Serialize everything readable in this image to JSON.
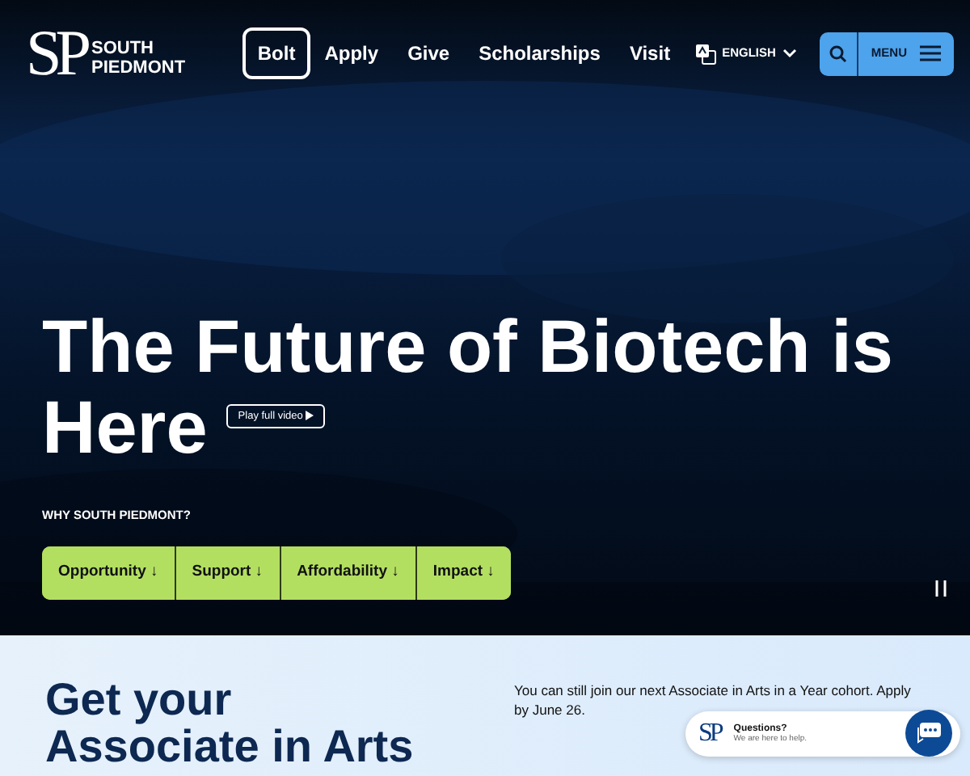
{
  "header": {
    "logo_initials": "SP",
    "logo_name": [
      "SOUTH",
      "PIEDMONT"
    ],
    "nav": [
      {
        "label": "Bolt",
        "selected": true
      },
      {
        "label": "Apply",
        "selected": false
      },
      {
        "label": "Give",
        "selected": false
      },
      {
        "label": "Scholarships",
        "selected": false
      },
      {
        "label": "Visit",
        "selected": false
      }
    ],
    "language": "ENGLISH",
    "menu": "MENU"
  },
  "hero": {
    "kind": "picture",
    "title_lines": [
      "The Future of Biotech is",
      "Here"
    ],
    "video_button": "Play full video",
    "eyebrow": "WHY SOUTH PIEDMONT?",
    "links": [
      "Opportunity ↓",
      "Support ↓",
      "Affordability ↓",
      "Impact ↓"
    ]
  },
  "promo": {
    "heading": [
      "Get your",
      "Associate in Arts"
    ],
    "text": "You can still join our next Associate in Arts in a Year cohort. Apply by June 26."
  },
  "chat": {
    "initials": "SP",
    "title": "Questions?",
    "subtitle": "We are here to help."
  }
}
